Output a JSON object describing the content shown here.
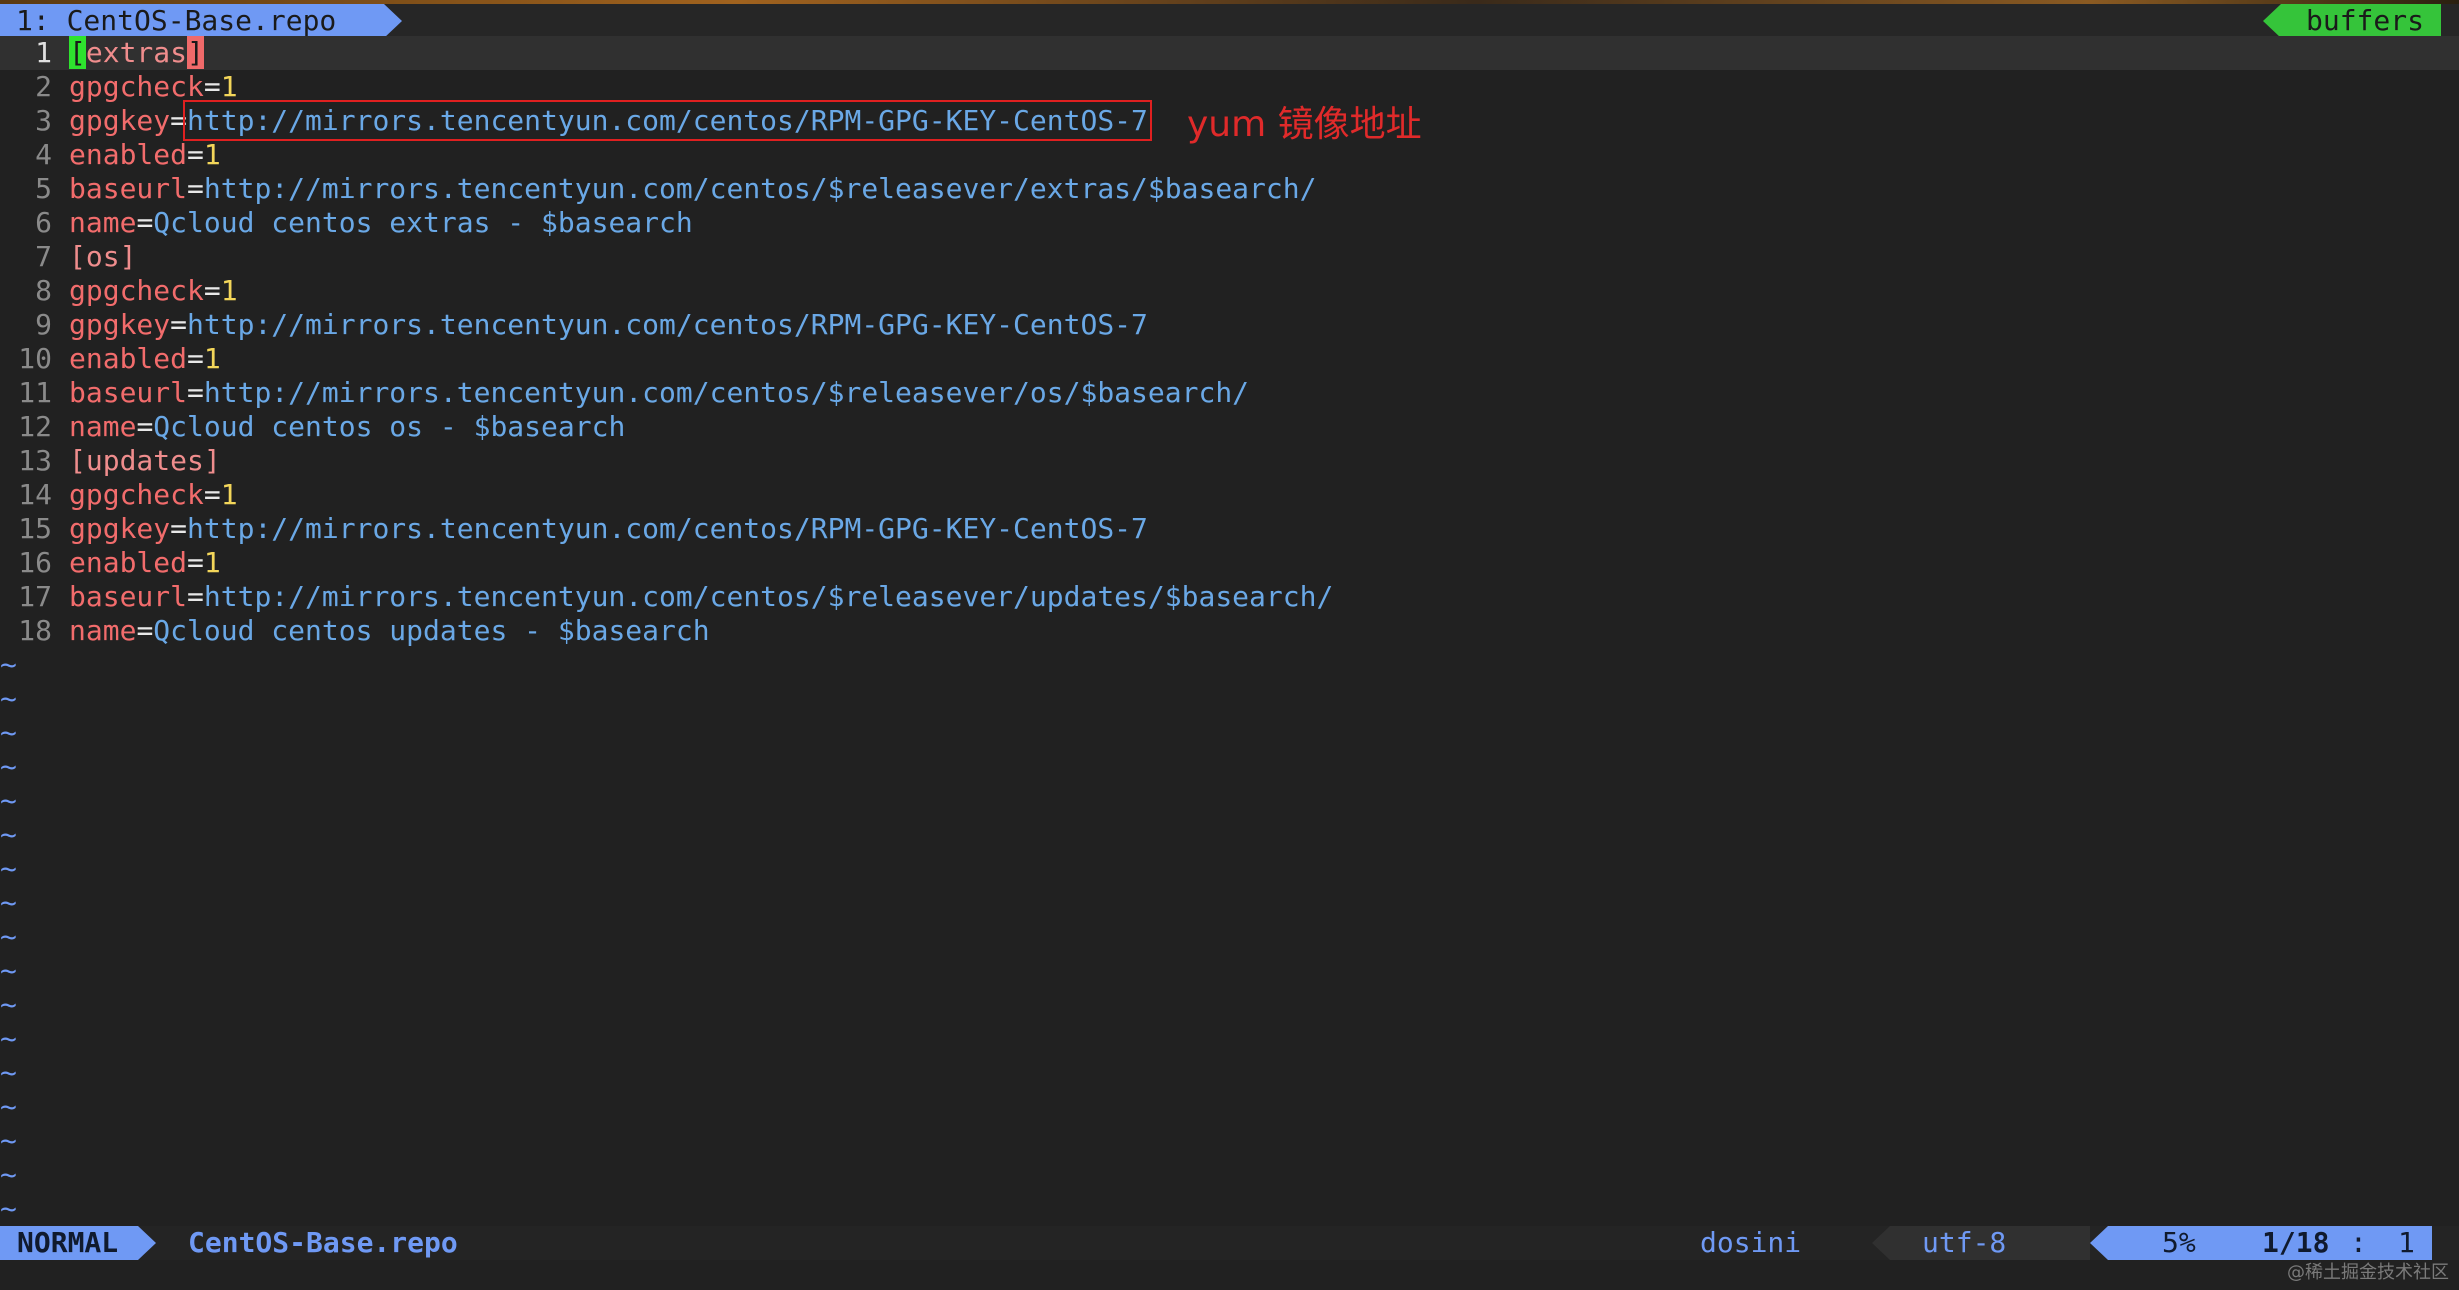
{
  "tabline": {
    "active_tab": "1: CentOS-Base.repo",
    "buffers_label": "buffers"
  },
  "lines": [
    {
      "num": "1",
      "key": "[extras]"
    },
    {
      "num": "2",
      "key": "gpgcheck",
      "eq": "=",
      "value": "1"
    },
    {
      "num": "3",
      "key": "gpgkey",
      "eq": "=",
      "value": "http://mirrors.tencentyun.com/centos/RPM-GPG-KEY-CentOS-7"
    },
    {
      "num": "4",
      "key": "enabled",
      "eq": "=",
      "value": "1"
    },
    {
      "num": "5",
      "key": "baseurl",
      "eq": "=",
      "value": "http://mirrors.tencentyun.com/centos/$releasever/extras/$basearch/"
    },
    {
      "num": "6",
      "key": "name",
      "eq": "=",
      "value": "Qcloud centos extras - $basearch"
    },
    {
      "num": "7",
      "key": "[os]"
    },
    {
      "num": "8",
      "key": "gpgcheck",
      "eq": "=",
      "value": "1"
    },
    {
      "num": "9",
      "key": "gpgkey",
      "eq": "=",
      "value": "http://mirrors.tencentyun.com/centos/RPM-GPG-KEY-CentOS-7"
    },
    {
      "num": "10",
      "key": "enabled",
      "eq": "=",
      "value": "1"
    },
    {
      "num": "11",
      "key": "baseurl",
      "eq": "=",
      "value": "http://mirrors.tencentyun.com/centos/$releasever/os/$basearch/"
    },
    {
      "num": "12",
      "key": "name",
      "eq": "=",
      "value": "Qcloud centos os - $basearch"
    },
    {
      "num": "13",
      "key": "[updates]"
    },
    {
      "num": "14",
      "key": "gpgcheck",
      "eq": "=",
      "value": "1"
    },
    {
      "num": "15",
      "key": "gpgkey",
      "eq": "=",
      "value": "http://mirrors.tencentyun.com/centos/RPM-GPG-KEY-CentOS-7"
    },
    {
      "num": "16",
      "key": "enabled",
      "eq": "=",
      "value": "1"
    },
    {
      "num": "17",
      "key": "baseurl",
      "eq": "=",
      "value": "http://mirrors.tencentyun.com/centos/$releasever/updates/$basearch/"
    },
    {
      "num": "18",
      "key": "name",
      "eq": "=",
      "value": "Qcloud centos updates - $basearch"
    }
  ],
  "section_open": "[",
  "section1_name": "extras",
  "section_close": "]",
  "tilde": "~",
  "annotation": "yum 镜像地址",
  "statusline": {
    "mode": "NORMAL",
    "filename": "CentOS-Base.repo",
    "filetype": "dosini",
    "encoding": "utf-8",
    "percent": "5%",
    "line_position": "1/18",
    "colon": ":",
    "column": "1"
  },
  "watermark": "@稀土掘金技术社区",
  "colors": {
    "accent_blue": "#6f99f4",
    "buffers_green": "#35c43a",
    "key_red": "#f26c6c",
    "value_blue": "#6aa8e6",
    "number_yellow": "#f3d65a",
    "annotation_red": "#e02a2a",
    "background": "#212121"
  }
}
